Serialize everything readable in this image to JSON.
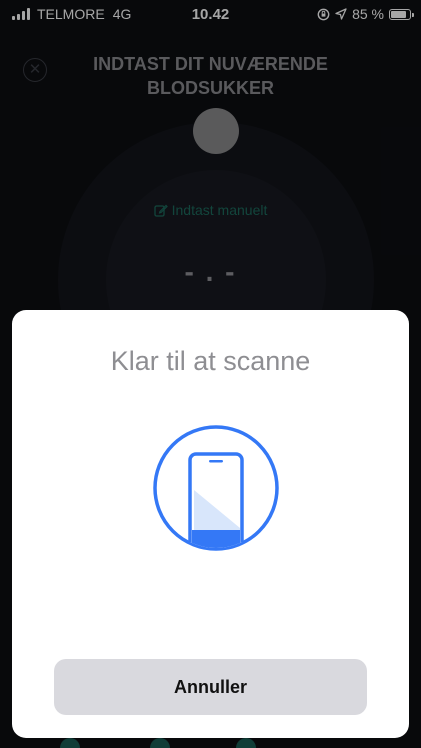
{
  "status_bar": {
    "carrier": "TELMORE",
    "network": "4G",
    "time": "10.42",
    "battery_percent": "85 %",
    "battery_level": 0.85,
    "icons": [
      "signal-bars-icon",
      "orientation-lock-icon",
      "location-arrow-icon",
      "battery-icon"
    ]
  },
  "background_screen": {
    "close_icon": "close-icon",
    "title": "INDTAST DIT NUVÆRENDE BLODSUKKER",
    "manual_entry_label": "Indtast manuelt",
    "manual_entry_icon": "edit-icon",
    "reading_placeholder": "- . -",
    "accent_color": "#1d6b5d"
  },
  "scan_sheet": {
    "title": "Klar til at scanne",
    "illustration_icon": "phone-scan-icon",
    "cancel_label": "Annuller",
    "accent_color": "#3478f6"
  }
}
